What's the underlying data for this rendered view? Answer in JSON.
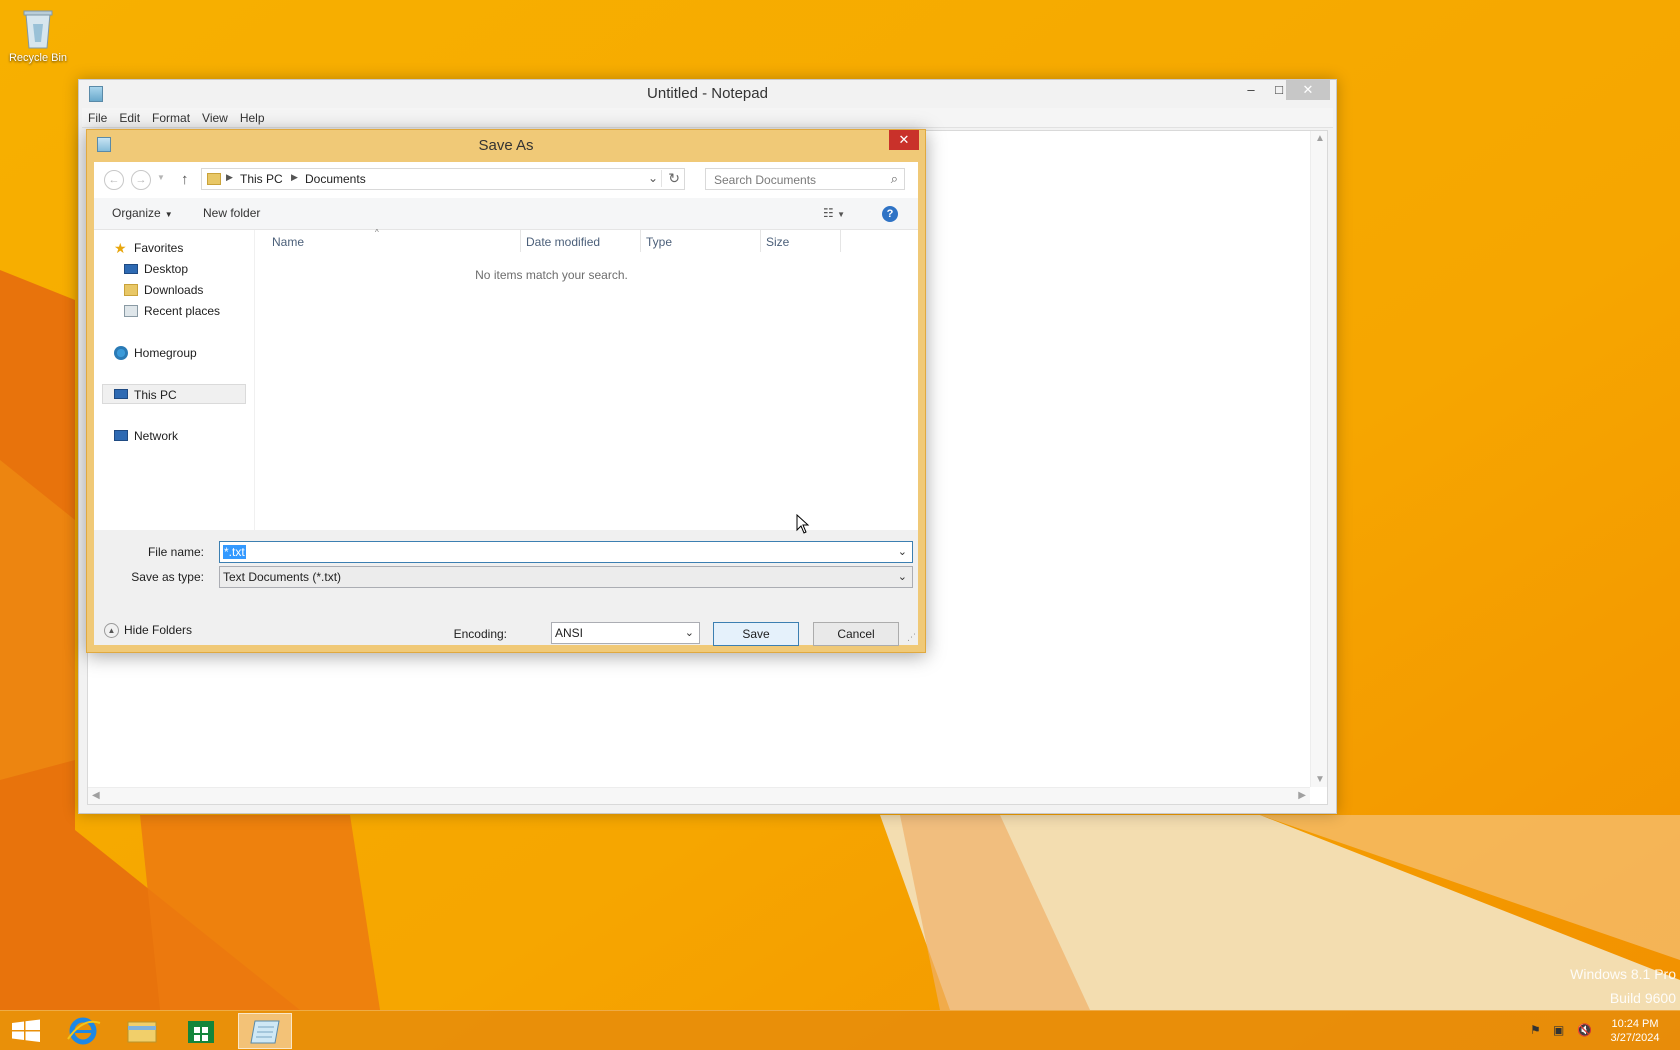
{
  "desktop": {
    "recycle_bin_label": "Recycle Bin",
    "watermark_line1": "Windows 8.1 Pro",
    "watermark_line2": "Build 9600"
  },
  "notepad": {
    "title": "Untitled - Notepad",
    "menu": [
      "File",
      "Edit",
      "Format",
      "View",
      "Help"
    ],
    "minimize_glyph": "–",
    "maximize_glyph": "□",
    "close_glyph": "✕"
  },
  "save_dialog": {
    "title": "Save As",
    "close_glyph": "✕",
    "breadcrumb": [
      "This PC",
      "Documents"
    ],
    "search_placeholder": "Search Documents",
    "toolbar": {
      "organize": "Organize",
      "new_folder": "New folder"
    },
    "nav": {
      "favorites": "Favorites",
      "desktop": "Desktop",
      "downloads": "Downloads",
      "recent_places": "Recent places",
      "homegroup": "Homegroup",
      "this_pc": "This PC",
      "network": "Network"
    },
    "columns": [
      "Name",
      "Date modified",
      "Type",
      "Size"
    ],
    "empty_message": "No items match your search.",
    "file_name_label": "File name:",
    "file_name_value": "*.txt",
    "save_as_type_label": "Save as type:",
    "save_as_type_value": "Text Documents (*.txt)",
    "hide_folders": "Hide Folders",
    "encoding_label": "Encoding:",
    "encoding_value": "ANSI",
    "save_button": "Save",
    "cancel_button": "Cancel"
  },
  "taskbar": {
    "time": "10:24 PM",
    "date": "3/27/2024",
    "pinned": [
      "start-button",
      "internet-explorer",
      "file-explorer",
      "store",
      "notepad"
    ]
  },
  "colors": {
    "wallpaper": "#f6a800",
    "dialog_frame": "#f0c977",
    "selection": "#3399ff",
    "taskbar": "#e68c0a"
  }
}
